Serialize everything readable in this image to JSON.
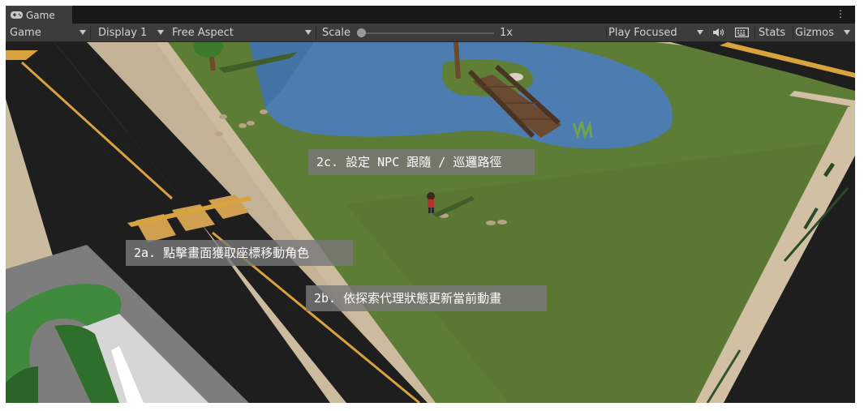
{
  "window": {
    "tab_label": "Game",
    "tab_icon": "gamepad-icon",
    "menu_icon": "more-vertical-icon"
  },
  "toolbar": {
    "view_mode": "Game",
    "display": "Display 1",
    "aspect": "Free Aspect",
    "scale_label": "Scale",
    "scale_value": "1x",
    "scale_fraction": 0.0,
    "play_mode": "Play Focused",
    "audio_icon": "speaker-icon",
    "keyboard_icon": "keyboard-icon",
    "stats_label": "Stats",
    "gizmos_label": "Gizmos"
  },
  "annotations": {
    "npc_follow": "2c. 設定 NPC 跟隨 / 巡邏路徑",
    "click_move": "2a. 點擊畫面獲取座標移動角色",
    "anim_update": "2b. 依探索代理狀態更新當前動畫"
  },
  "colors": {
    "editor_dark": "#191919",
    "toolbar": "#3c3c3c",
    "grass": "#5a7a35",
    "water": "#4f7fb0",
    "road": "#1e1e1e",
    "sidewalk": "#d2c0a4",
    "road_line": "#d8a23c",
    "pipe": "#3f8a3c"
  }
}
